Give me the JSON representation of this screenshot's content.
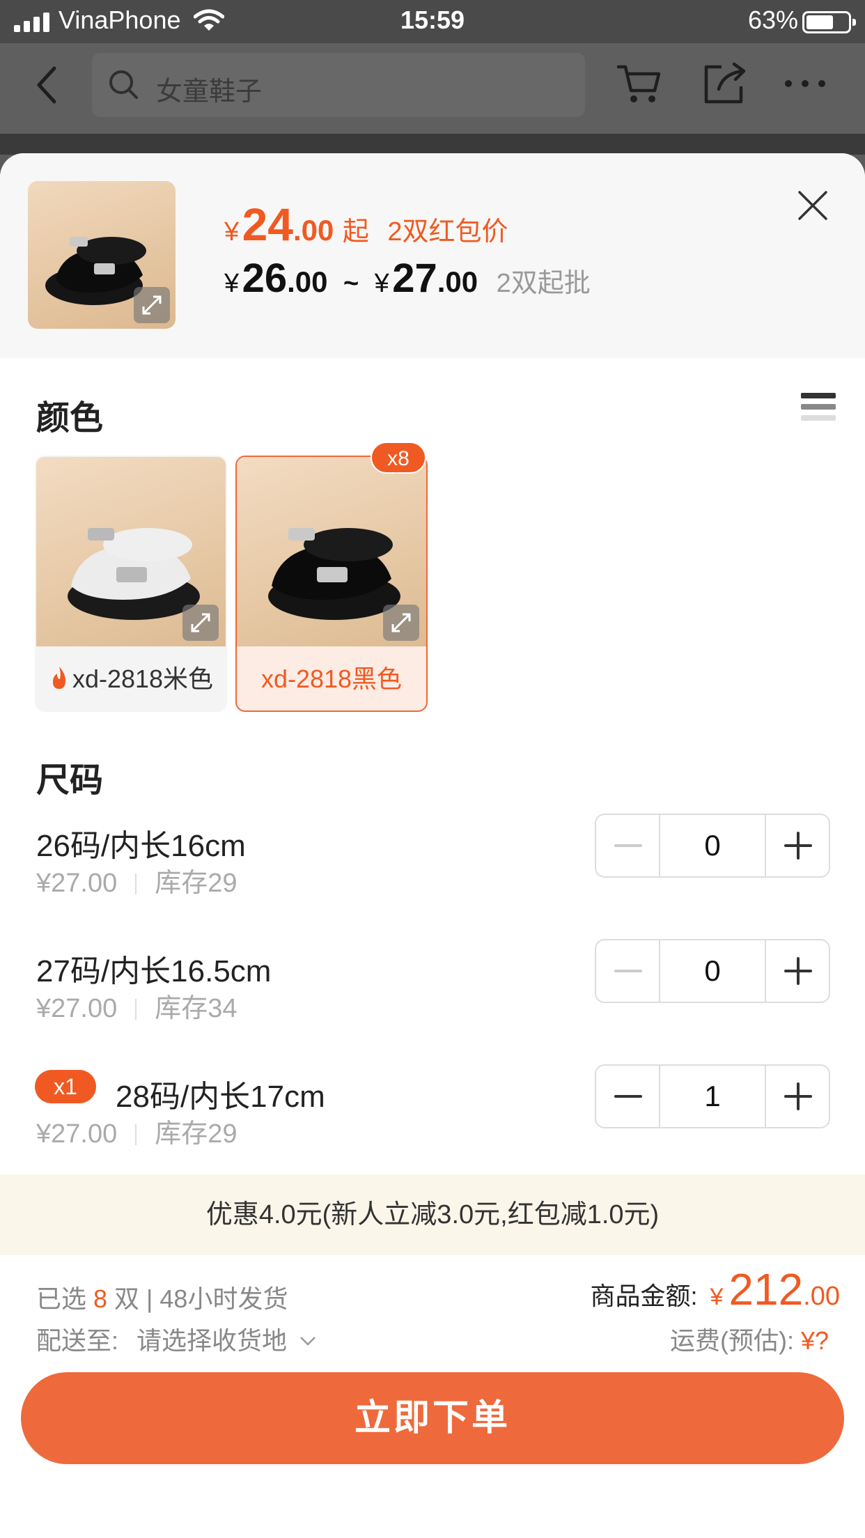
{
  "status_bar": {
    "carrier": "VinaPhone",
    "time": "15:59",
    "battery": "63%"
  },
  "header": {
    "search_placeholder": "女童鞋子"
  },
  "product": {
    "promo_currency": "¥",
    "promo_price_int": "24",
    "promo_price_dec": ".00",
    "promo_qi": "起",
    "promo_tag": "2双红包价",
    "range_currency_1": "¥",
    "range_low_int": "26",
    "range_low_dec": ".00",
    "range_tilde": "~",
    "range_currency_2": "¥",
    "range_high_int": "27",
    "range_high_dec": ".00",
    "min_order": "2双起批"
  },
  "color_section": {
    "title": "颜色",
    "options": [
      {
        "label": "xd-2818米色",
        "selected": false
      },
      {
        "label": "xd-2818黑色",
        "selected": true,
        "badge": "x8"
      }
    ]
  },
  "size_section": {
    "title": "尺码",
    "rows": [
      {
        "name": "26码/内长16cm",
        "price": "¥27.00",
        "stock": "库存29",
        "qty": "0"
      },
      {
        "name": "27码/内长16.5cm",
        "price": "¥27.00",
        "stock": "库存34",
        "qty": "0"
      },
      {
        "name": "28码/内长17cm",
        "price": "¥27.00",
        "stock": "库存29",
        "qty": "1",
        "badge": "x1"
      }
    ]
  },
  "discount_text": "优惠4.0元(新人立减3.0元,红包减1.0元)",
  "summary": {
    "selected_prefix": "已选",
    "selected_count": "8",
    "selected_suffix": "双 | 48小时发货",
    "ship_label": "配送至:",
    "ship_value": "请选择收货地",
    "total_label": "商品金额:",
    "total_currency": "¥",
    "total_int": "212",
    "total_dec": ".00",
    "freight_label": "运费(预估):",
    "freight_value": "¥?"
  },
  "order_button": "立即下单",
  "colors": {
    "accent": "#f05a22",
    "button": "#ee6a3c",
    "discount_bg": "#fbf6ea"
  }
}
